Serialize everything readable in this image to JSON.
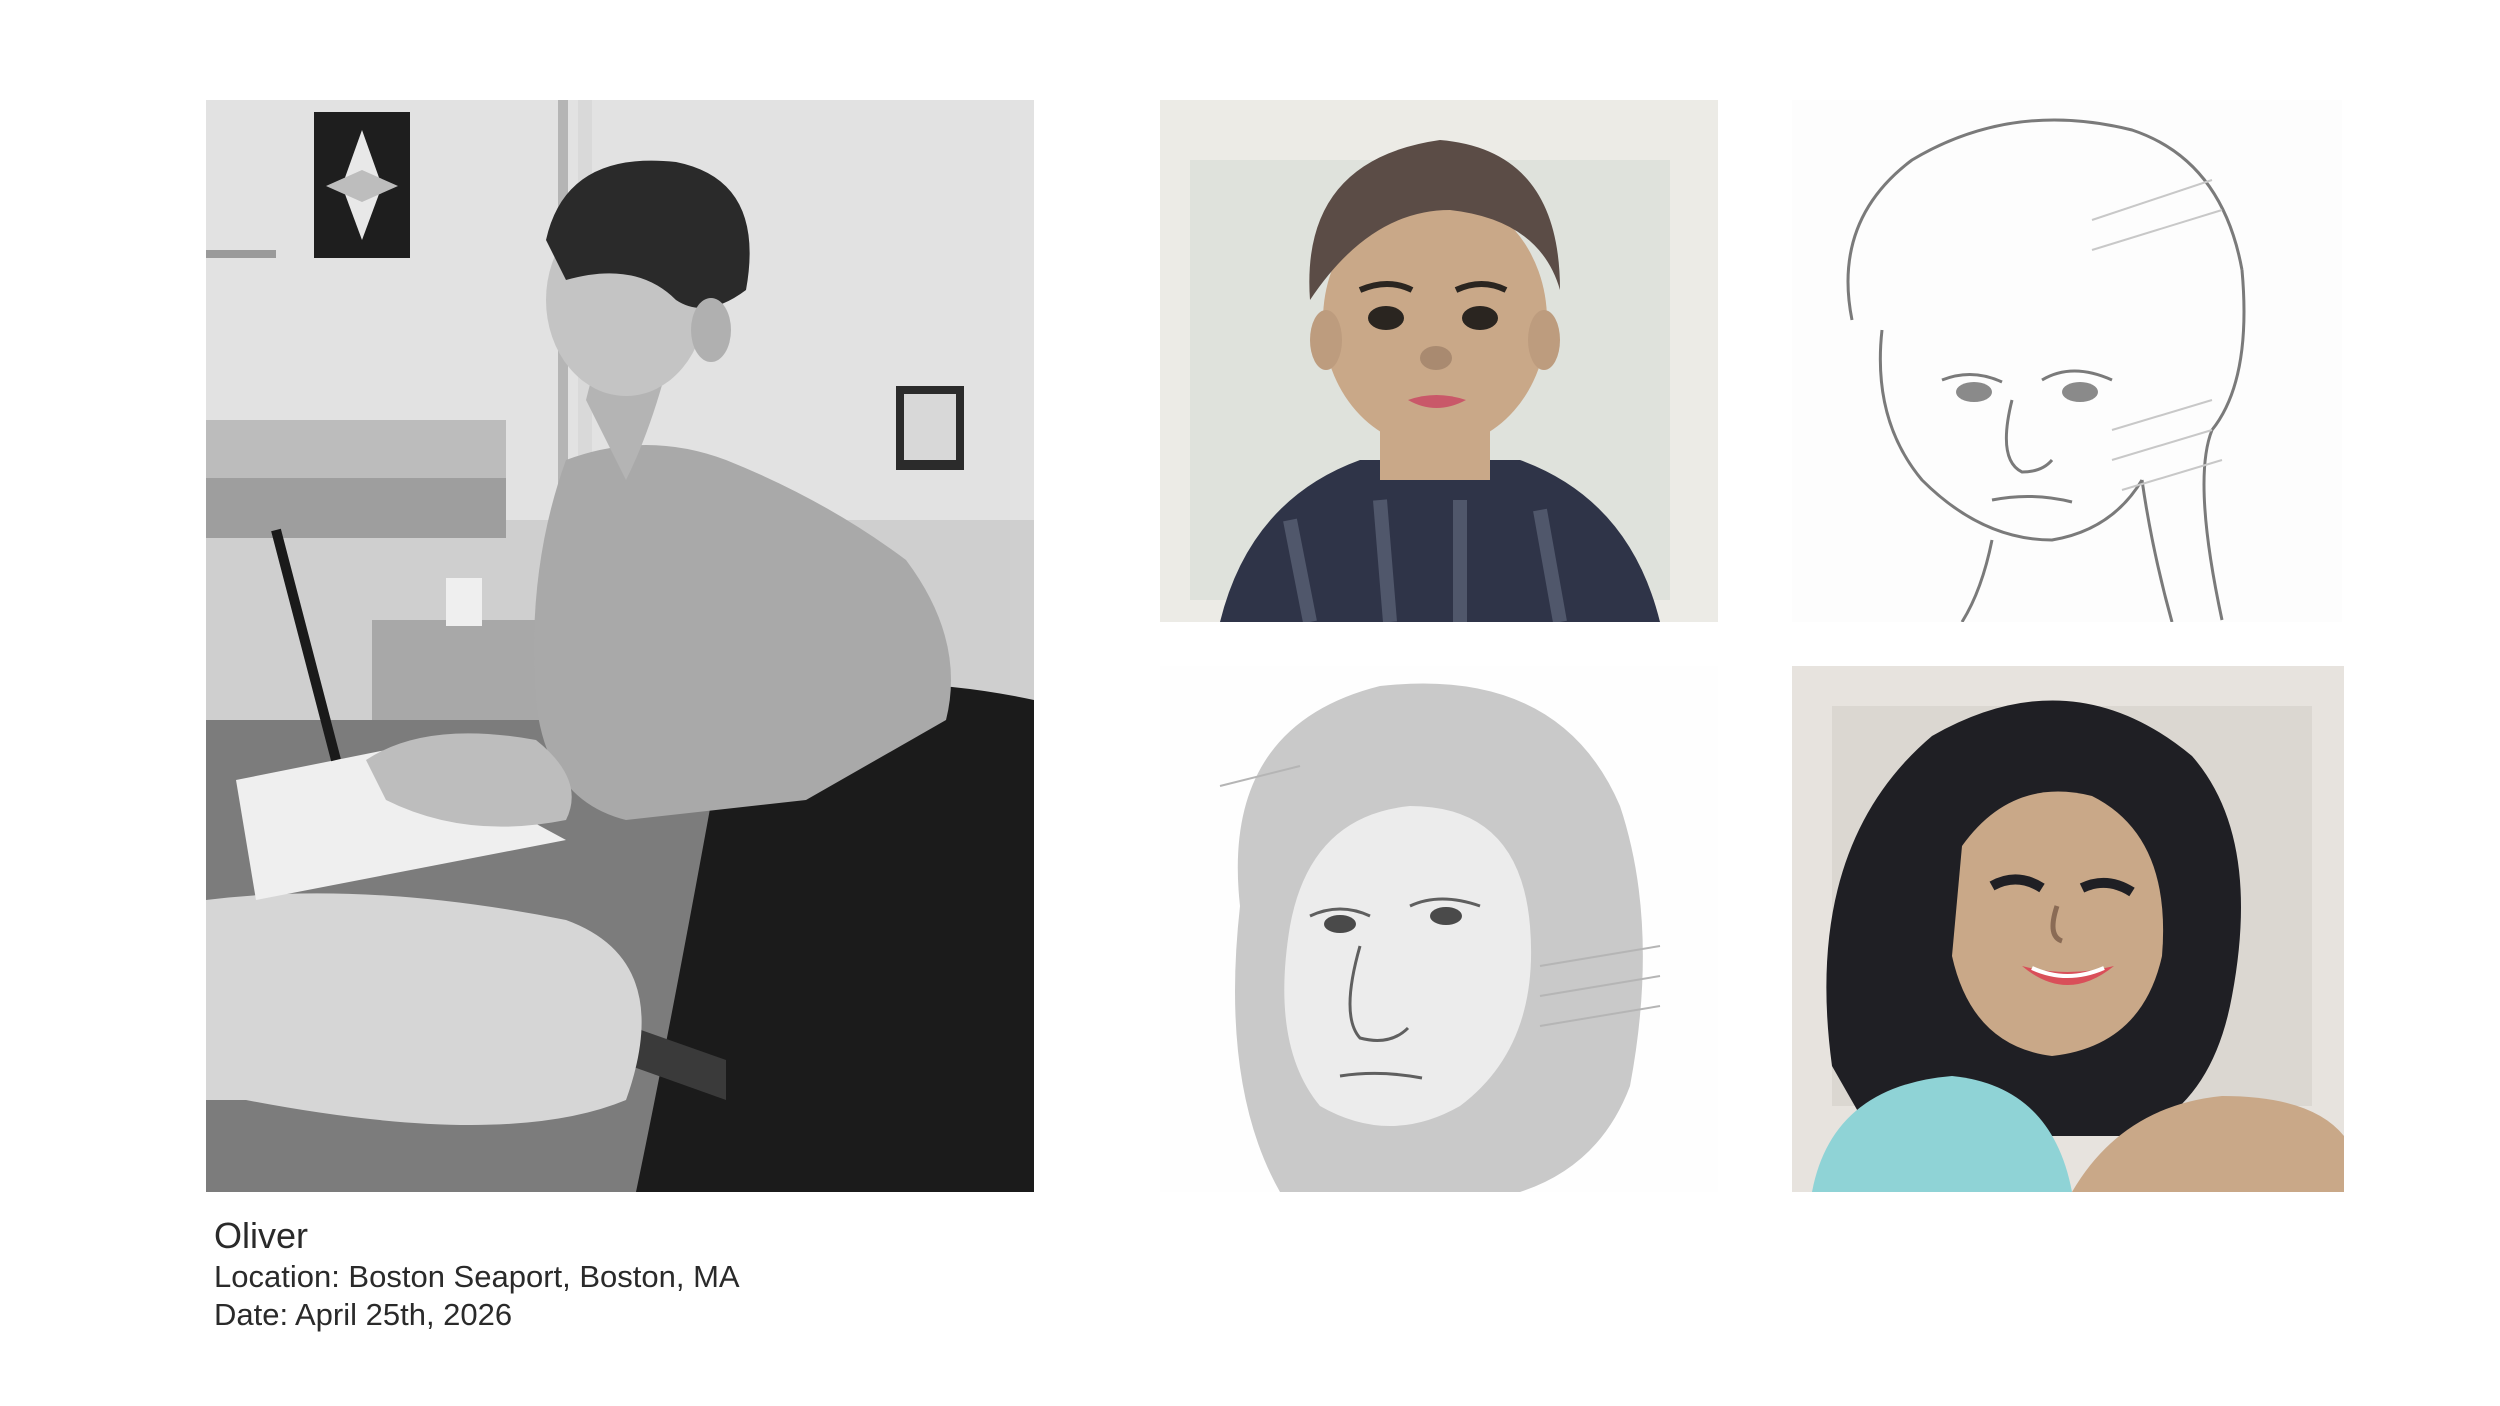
{
  "gallery": {
    "main_photo": {
      "alt": "Artist Oliver sketching a portrait in a studio",
      "icon": "photo-artist-at-work"
    },
    "portraits": [
      {
        "alt": "Marker portrait of a young boy",
        "icon": "portrait-marker-boy"
      },
      {
        "alt": "Pencil sketch of a young man",
        "icon": "portrait-pencil-man"
      },
      {
        "alt": "Pencil sketch of a young woman",
        "icon": "portrait-pencil-woman"
      },
      {
        "alt": "Marker portrait of a smiling woman",
        "icon": "portrait-marker-woman"
      }
    ]
  },
  "caption": {
    "name": "Oliver",
    "location": "Location: Boston Seaport, Boston, MA",
    "date": "Date: April 25th, 2026"
  },
  "colors": {
    "background": "#ffffff",
    "caption_text": "#2a2a2a",
    "marker_skin": "#c9a888",
    "marker_navy": "#2f3448",
    "marker_cyan": "#8fd3d6"
  }
}
